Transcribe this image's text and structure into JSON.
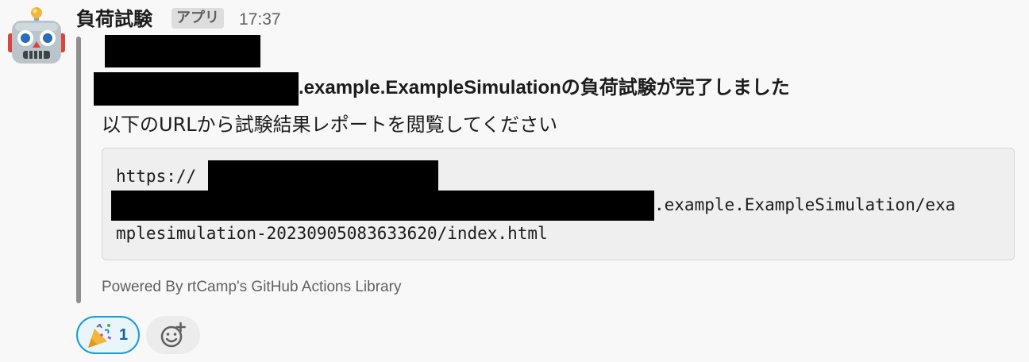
{
  "message": {
    "sender": "負荷試験",
    "badge": "アプリ",
    "time": "17:37",
    "avatar_icon": "robot-face-icon"
  },
  "attachment": {
    "title_suffix": ".example.ExampleSimulationの負荷試験が完了しました",
    "subtitle": "以下のURLから試験結果レポートを閲覧してください",
    "code_line1": "https://",
    "code_line2_suffix": ".example.ExampleSimulation/exa",
    "code_line3": "mplesimulation-20230905083633620/index.html",
    "footer": "Powered By rtCamp's GitHub Actions Library",
    "bar_color": "#8f8f8f"
  },
  "reactions": [
    {
      "icon": "party-popper-icon",
      "count": "1"
    }
  ],
  "add_reaction_icon": "add-emoji-icon",
  "colors": {
    "accent": "#1d9bd1",
    "background": "#f8f8f8"
  }
}
